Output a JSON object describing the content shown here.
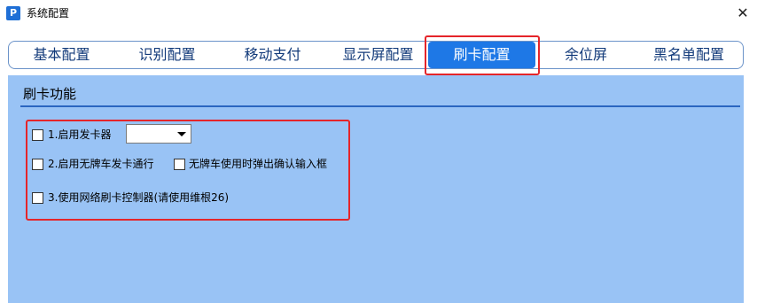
{
  "window": {
    "title": "系统配置",
    "app_icon_letter": "P",
    "close_glyph": "✕"
  },
  "tabs": [
    {
      "label": "基本配置",
      "active": false
    },
    {
      "label": "识别配置",
      "active": false
    },
    {
      "label": "移动支付",
      "active": false
    },
    {
      "label": "显示屏配置",
      "active": false
    },
    {
      "label": "刷卡配置",
      "active": true
    },
    {
      "label": "余位屏",
      "active": false
    },
    {
      "label": "黑名单配置",
      "active": false
    }
  ],
  "section": {
    "title": "刷卡功能"
  },
  "options": {
    "enable_card_issuer": {
      "label": "1.启用发卡器",
      "checked": false
    },
    "card_issuer_select": {
      "value": ""
    },
    "enable_unplated_card_pass": {
      "label": "2.启用无牌车发卡通行",
      "checked": false
    },
    "unplated_confirm_popup": {
      "label": "无牌车使用时弹出确认输入框",
      "checked": false
    },
    "network_card_controller": {
      "label": "3.使用网络刷卡控制器(请使用维根26)",
      "checked": false
    }
  },
  "colors": {
    "accent": "#1e78e6",
    "panel_bg": "#99c3f5",
    "highlight_frame": "#e5252a"
  }
}
